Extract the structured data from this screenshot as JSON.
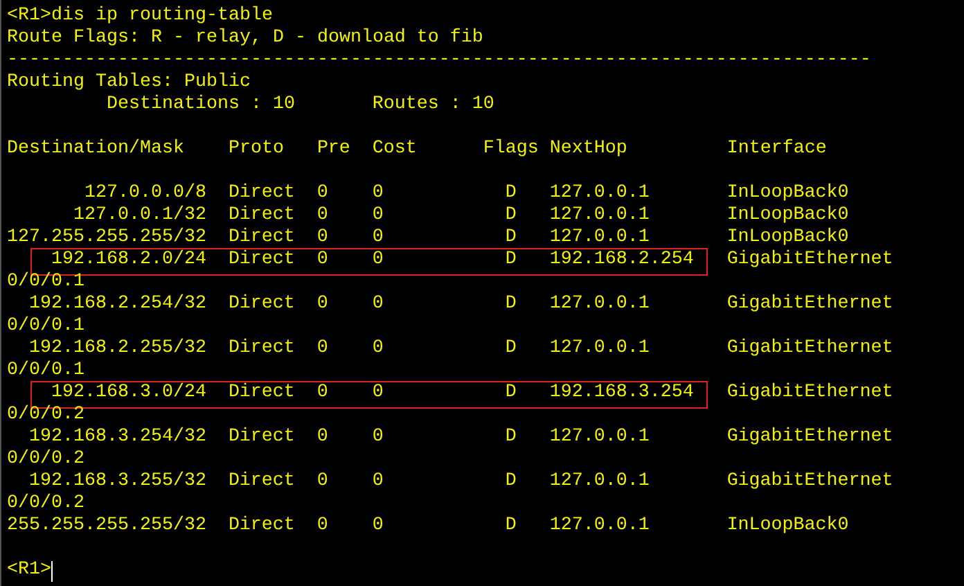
{
  "command": {
    "prompt": "<R1>",
    "text": "dis ip routing-table"
  },
  "flags_legend": "Route Flags: R - relay, D - download to fib",
  "separator": "------------------------------------------------------------------------------",
  "table_name": "Routing Tables: Public",
  "summary": {
    "destinations": "Destinations : 10",
    "routes": "Routes : 10"
  },
  "columns": [
    "Destination/Mask",
    "Proto",
    "Pre",
    "Cost",
    "Flags",
    "NextHop",
    "Interface"
  ],
  "routes": [
    {
      "destination": "127.0.0.0/8",
      "proto": "Direct",
      "pre": "0",
      "cost": "0",
      "flags": "D",
      "nexthop": "127.0.0.1",
      "interface": "InLoopBack0",
      "highlighted": false
    },
    {
      "destination": "127.0.0.1/32",
      "proto": "Direct",
      "pre": "0",
      "cost": "0",
      "flags": "D",
      "nexthop": "127.0.0.1",
      "interface": "InLoopBack0",
      "highlighted": false
    },
    {
      "destination": "127.255.255.255/32",
      "proto": "Direct",
      "pre": "0",
      "cost": "0",
      "flags": "D",
      "nexthop": "127.0.0.1",
      "interface": "InLoopBack0",
      "highlighted": false
    },
    {
      "destination": "192.168.2.0/24",
      "proto": "Direct",
      "pre": "0",
      "cost": "0",
      "flags": "D",
      "nexthop": "192.168.2.254",
      "interface": "GigabitEthernet",
      "interface_wrap": "0/0/0.1",
      "highlighted": true
    },
    {
      "destination": "192.168.2.254/32",
      "proto": "Direct",
      "pre": "0",
      "cost": "0",
      "flags": "D",
      "nexthop": "127.0.0.1",
      "interface": "GigabitEthernet",
      "interface_wrap": "0/0/0.1",
      "highlighted": false
    },
    {
      "destination": "192.168.2.255/32",
      "proto": "Direct",
      "pre": "0",
      "cost": "0",
      "flags": "D",
      "nexthop": "127.0.0.1",
      "interface": "GigabitEthernet",
      "interface_wrap": "0/0/0.1",
      "highlighted": false
    },
    {
      "destination": "192.168.3.0/24",
      "proto": "Direct",
      "pre": "0",
      "cost": "0",
      "flags": "D",
      "nexthop": "192.168.3.254",
      "interface": "GigabitEthernet",
      "interface_wrap": "0/0/0.2",
      "highlighted": true
    },
    {
      "destination": "192.168.3.254/32",
      "proto": "Direct",
      "pre": "0",
      "cost": "0",
      "flags": "D",
      "nexthop": "127.0.0.1",
      "interface": "GigabitEthernet",
      "interface_wrap": "0/0/0.2",
      "highlighted": false
    },
    {
      "destination": "192.168.3.255/32",
      "proto": "Direct",
      "pre": "0",
      "cost": "0",
      "flags": "D",
      "nexthop": "127.0.0.1",
      "interface": "GigabitEthernet",
      "interface_wrap": "0/0/0.2",
      "highlighted": false
    },
    {
      "destination": "255.255.255.255/32",
      "proto": "Direct",
      "pre": "0",
      "cost": "0",
      "flags": "D",
      "nexthop": "127.0.0.1",
      "interface": "InLoopBack0",
      "highlighted": false
    }
  ],
  "final_prompt": "<R1>"
}
